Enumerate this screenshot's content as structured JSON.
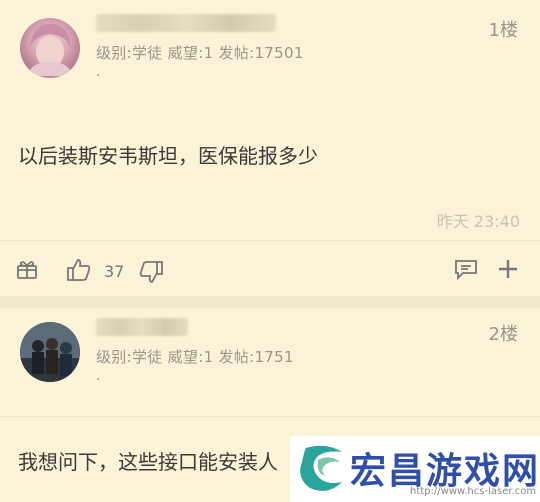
{
  "posts": [
    {
      "floor": "1楼",
      "meta": "级别:学徒 威望:1 发帖:17501",
      "dot": ".",
      "content": "以后装斯安韦斯坦，医保能报多少",
      "time": "昨天 23:40",
      "likes": "37"
    },
    {
      "floor": "2楼",
      "meta": "级别:学徒 威望:1 发帖:1751",
      "dot": ".",
      "content": "我想问下，这些接口能安装人"
    }
  ],
  "watermark": {
    "title": "宏昌游戏网",
    "url": "http://www.hcs-laser.com"
  }
}
